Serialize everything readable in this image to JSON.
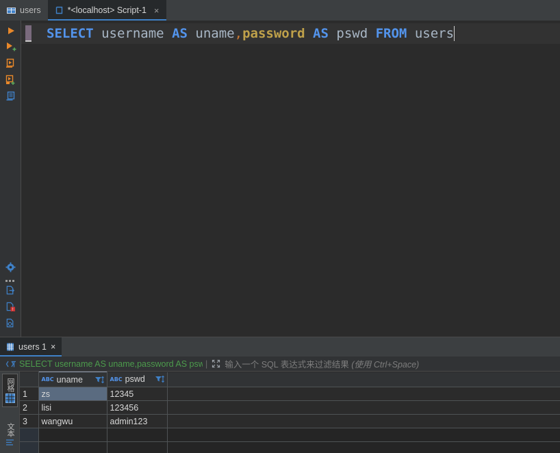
{
  "app": {
    "theme_bg": "#2b2b2b",
    "accent": "#3f81c8",
    "keyword_color": "#5394ec",
    "string_color": "#bfa14a",
    "sql_green": "#4c9b4c"
  },
  "editor_tabs": [
    {
      "label": "users",
      "icon": "table-icon",
      "active": false,
      "closable": false
    },
    {
      "label": "*<localhost> Script-1",
      "icon": "console-icon",
      "active": true,
      "closable": true,
      "close_glyph": "×"
    }
  ],
  "gutter_icons": [
    {
      "name": "run-statement-icon"
    },
    {
      "name": "run-statement-new-tab-icon"
    },
    {
      "name": "execute-to-file-icon"
    },
    {
      "name": "execute-to-file-new-icon"
    },
    {
      "name": "show-query-plan-icon"
    }
  ],
  "editor_side_icons": [
    {
      "name": "settings-gear-icon"
    },
    {
      "name": "dots-handle-icon"
    },
    {
      "name": "export-data-icon"
    },
    {
      "name": "error-document-icon"
    },
    {
      "name": "preview-document-icon"
    }
  ],
  "code": {
    "tokens": [
      {
        "text": "SELECT",
        "kind": "kw"
      },
      {
        "text": " ",
        "kind": "plain"
      },
      {
        "text": "username",
        "kind": "id"
      },
      {
        "text": " ",
        "kind": "plain"
      },
      {
        "text": "AS",
        "kind": "kw"
      },
      {
        "text": " ",
        "kind": "plain"
      },
      {
        "text": "uname",
        "kind": "id"
      },
      {
        "text": ",",
        "kind": "punc"
      },
      {
        "text": "password",
        "kind": "str"
      },
      {
        "text": " ",
        "kind": "plain"
      },
      {
        "text": "AS",
        "kind": "kw"
      },
      {
        "text": " ",
        "kind": "plain"
      },
      {
        "text": "pswd",
        "kind": "id"
      },
      {
        "text": " ",
        "kind": "plain"
      },
      {
        "text": "FROM",
        "kind": "kw"
      },
      {
        "text": " ",
        "kind": "plain"
      },
      {
        "text": "users",
        "kind": "id"
      }
    ],
    "full_text": "SELECT username AS uname,password AS pswd FROM users"
  },
  "results": {
    "tab": {
      "label": "users 1",
      "icon": "result-table-icon",
      "close_glyph": "×"
    },
    "filter": {
      "icon": "sql-filter-icon",
      "applied_query": "SELECT username AS uname,password AS pswd ",
      "separator": "|",
      "expand_icon": "expand-editor-icon",
      "placeholder_main": "输入一个 SQL 表达式来过滤结果",
      "placeholder_hint": "(使用 Ctrl+Space)"
    },
    "view_tabs": [
      {
        "label": "网格",
        "icon": "grid-icon",
        "selected": true
      },
      {
        "label": "文本",
        "icon": "text-icon",
        "selected": false
      }
    ],
    "grid": {
      "columns": [
        {
          "name": "uname",
          "type_badge": "ABC",
          "sort_icon": "sort-filter-icon",
          "selected": true
        },
        {
          "name": "pswd",
          "type_badge": "ABC",
          "sort_icon": "sort-filter-icon",
          "selected": false
        }
      ],
      "rows": [
        {
          "no": "1",
          "uname": "zs",
          "pswd": "12345",
          "selected_cell": "uname"
        },
        {
          "no": "2",
          "uname": "lisi",
          "pswd": "123456",
          "selected_cell": null
        },
        {
          "no": "3",
          "uname": "wangwu",
          "pswd": "admin123",
          "selected_cell": null
        }
      ],
      "empty_row_count": 2
    }
  }
}
